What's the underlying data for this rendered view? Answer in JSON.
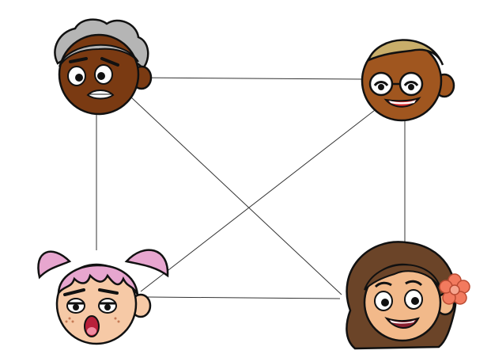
{
  "diagram": {
    "kind": "complete-graph",
    "nodes": [
      {
        "id": "top-left",
        "icon": "grey-haired-man-face-icon",
        "skin": "#7a3a12",
        "hair": "#b5b5b5",
        "expression": "worried"
      },
      {
        "id": "top-right",
        "icon": "glasses-boy-face-icon",
        "skin": "#a0561f",
        "hair": "#c9ae6a",
        "expression": "smiling"
      },
      {
        "id": "bottom-left",
        "icon": "pink-pigtails-girl-face-icon",
        "skin": "#f6c9a6",
        "hair": "#e7a6cf",
        "expression": "bored"
      },
      {
        "id": "bottom-right",
        "icon": "flower-girl-face-icon",
        "skin": "#f2b98a",
        "hair": "#6b4428",
        "accessory": "#f27a5e",
        "expression": "happy"
      }
    ],
    "edges": [
      [
        "top-left",
        "top-right"
      ],
      [
        "top-left",
        "bottom-left"
      ],
      [
        "top-left",
        "bottom-right"
      ],
      [
        "top-right",
        "bottom-left"
      ],
      [
        "top-right",
        "bottom-right"
      ],
      [
        "bottom-left",
        "bottom-right"
      ]
    ],
    "edge_color": "#333333",
    "outline_color": "#111111"
  }
}
